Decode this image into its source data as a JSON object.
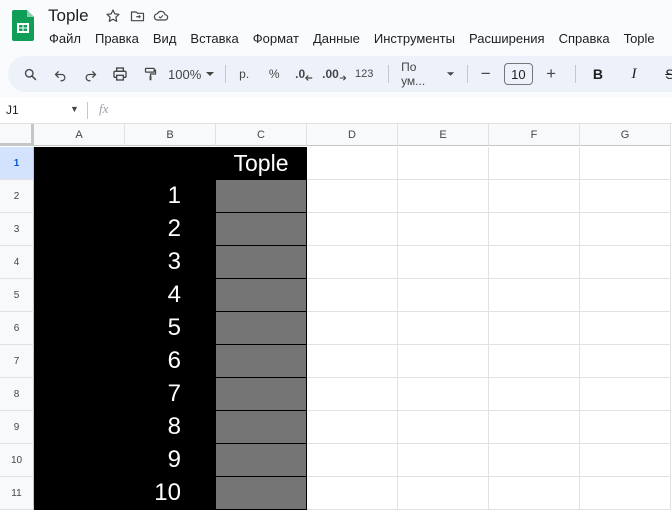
{
  "app": {
    "doc_title": "Tople",
    "menu": [
      "Файл",
      "Правка",
      "Вид",
      "Вставка",
      "Формат",
      "Данные",
      "Инструменты",
      "Расширения",
      "Справка",
      "Tople"
    ]
  },
  "toolbar": {
    "zoom": "100%",
    "currency": "р.",
    "percent": "%",
    "dec_decrease": ".0",
    "dec_increase": ".00",
    "number_format": "123",
    "font": "По ум...",
    "font_size": "10",
    "minus": "−",
    "plus": "+",
    "bold": "B",
    "italic": "I",
    "strike": "S"
  },
  "formula_bar": {
    "name_box": "J1",
    "fx_label": "fx"
  },
  "grid": {
    "columns": [
      "A",
      "B",
      "C",
      "D",
      "E",
      "F",
      "G"
    ],
    "rows": [
      "1",
      "2",
      "3",
      "4",
      "5",
      "6",
      "7",
      "8",
      "9",
      "10",
      "11"
    ],
    "header_cell": "Tople",
    "values": [
      "1",
      "2",
      "3",
      "4",
      "5",
      "6",
      "7",
      "8",
      "9",
      "10"
    ]
  },
  "colors": {
    "fill_black": "#000000",
    "fill_gray": "#757575",
    "active_row_header": "#d3e3fd",
    "toolbar_bg": "#edf2fa",
    "sheets_green": "#0f9d58"
  }
}
